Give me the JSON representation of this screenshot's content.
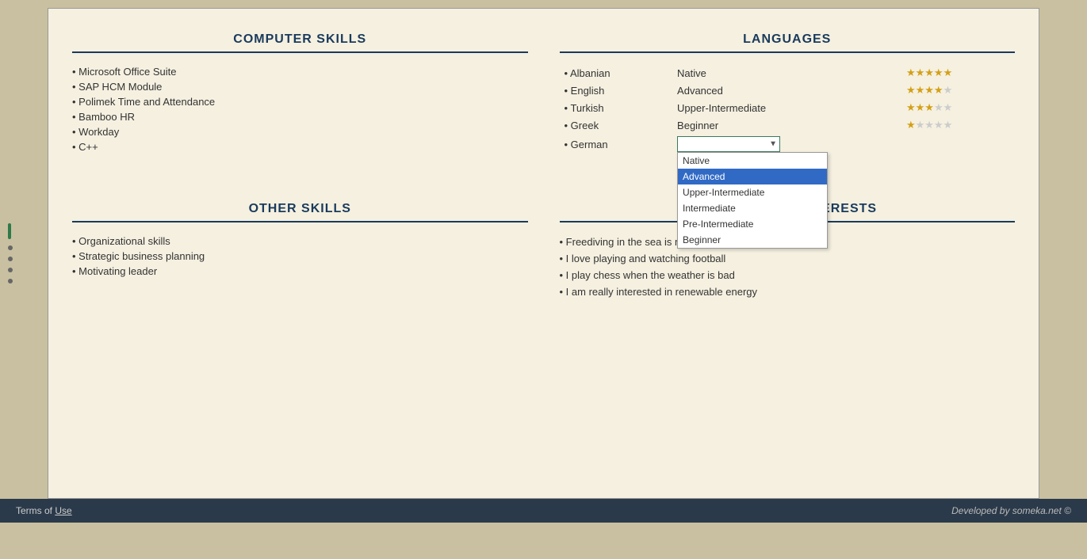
{
  "page": {
    "background": "#c8c0a0"
  },
  "computer_skills": {
    "title": "COMPUTER SKILLS",
    "items": [
      "Microsoft Office Suite",
      "SAP HCM Module",
      "Polimek Time and Attendance",
      "Bamboo HR",
      "Workday",
      "C++"
    ]
  },
  "languages": {
    "title": "LANGUAGES",
    "entries": [
      {
        "language": "Albanian",
        "level": "Native",
        "stars": 5,
        "max": 5
      },
      {
        "language": "English",
        "level": "Advanced",
        "stars": 4,
        "max": 5
      },
      {
        "language": "Turkish",
        "level": "Upper-Intermediate",
        "stars": 3,
        "max": 5
      },
      {
        "language": "Greek",
        "level": "Beginner",
        "stars": 1,
        "max": 5
      },
      {
        "language": "German",
        "level": "",
        "stars": 0,
        "max": 5
      }
    ],
    "dropdown": {
      "selected": "Advanced",
      "options": [
        "Native",
        "Advanced",
        "Upper-Intermediate",
        "Intermediate",
        "Pre-Intermediate",
        "Beginner"
      ]
    }
  },
  "other_skills": {
    "title": "OTHER SKILLS",
    "items": [
      "Organizational skills",
      "Strategic  business planning",
      "Motivating leader"
    ]
  },
  "hobbies": {
    "title": "HOBBIES AND INTERESTS",
    "items": [
      "Freediving in the sea is my favourite activity",
      "I love playing and watching football",
      "I play chess when the weather is bad",
      "I am really interested in renewable energy"
    ]
  },
  "footer": {
    "terms_label": "Terms of ",
    "terms_link": "Use",
    "developed": "Developed by someka.net ©"
  }
}
